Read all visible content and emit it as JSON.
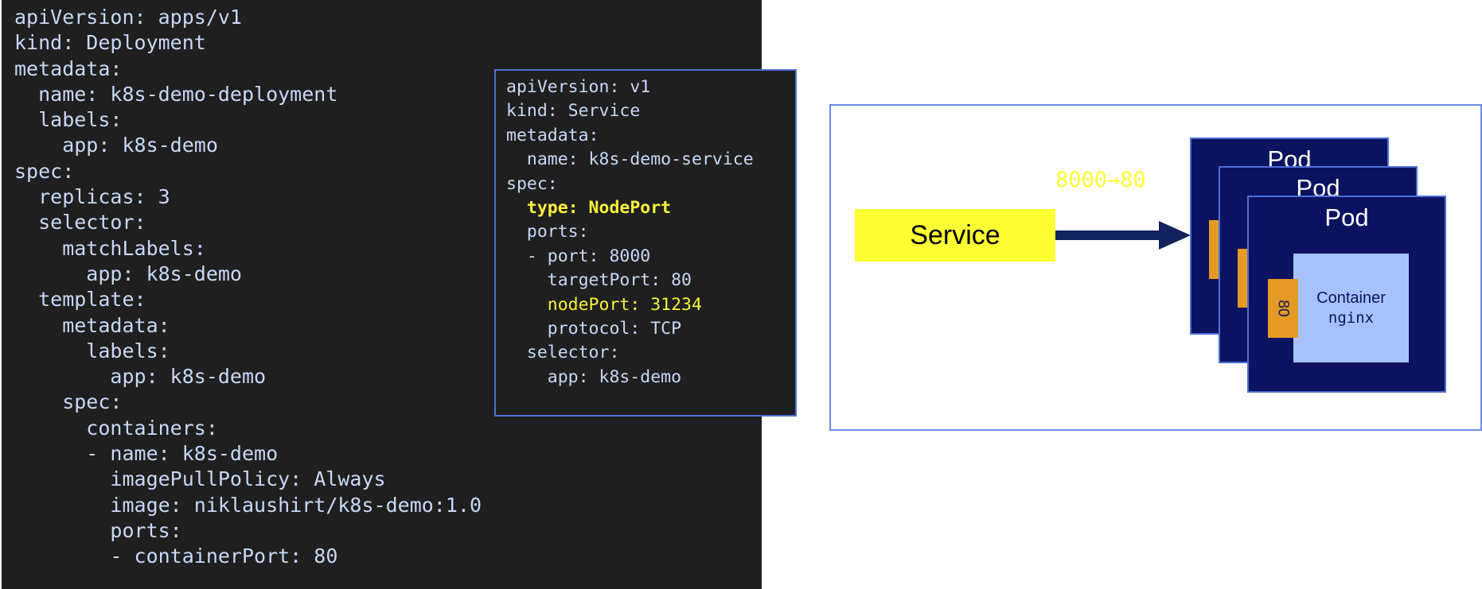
{
  "deployment_yaml": {
    "lines": [
      "apiVersion: apps/v1",
      "kind: Deployment",
      "metadata:",
      "  name: k8s-demo-deployment",
      "  labels:",
      "    app: k8s-demo",
      "spec:",
      "  replicas: 3",
      "  selector:",
      "    matchLabels:",
      "      app: k8s-demo",
      "  template:",
      "    metadata:",
      "      labels:",
      "        app: k8s-demo",
      "    spec:",
      "      containers:",
      "      - name: k8s-demo",
      "        imagePullPolicy: Always",
      "        image: niklaushirt/k8s-demo:1.0",
      "        ports:",
      "        - containerPort: 80"
    ]
  },
  "service_yaml": {
    "line1": "apiVersion: v1",
    "line2": "kind: Service",
    "line3": "metadata:",
    "line4": "  name: k8s-demo-service",
    "line5": "spec:",
    "line6": "  type: NodePort",
    "line7": "  ports:",
    "line8": "  - port: 8000",
    "line9": "    targetPort: 80",
    "line10": "    nodePort: 31234",
    "line11": "    protocol: TCP",
    "line12": "  selector:",
    "line13": "    app: k8s-demo"
  },
  "diagram": {
    "service_label": "Service",
    "port_mapping": "8000→80",
    "pods": [
      {
        "title": "Pod"
      },
      {
        "title": "Pod"
      },
      {
        "title": "Pod"
      }
    ],
    "container_title": "Container",
    "container_image": "nginx",
    "container_port": "80",
    "colors": {
      "service_fill": "#ffff33",
      "pod_fill": "#0b1360",
      "container_fill": "#a7c3ff",
      "port_fill": "#e49a24",
      "arrow": "#13235e",
      "code_bg": "#1f1f1f",
      "code_highlight": "#f7f23a"
    }
  }
}
